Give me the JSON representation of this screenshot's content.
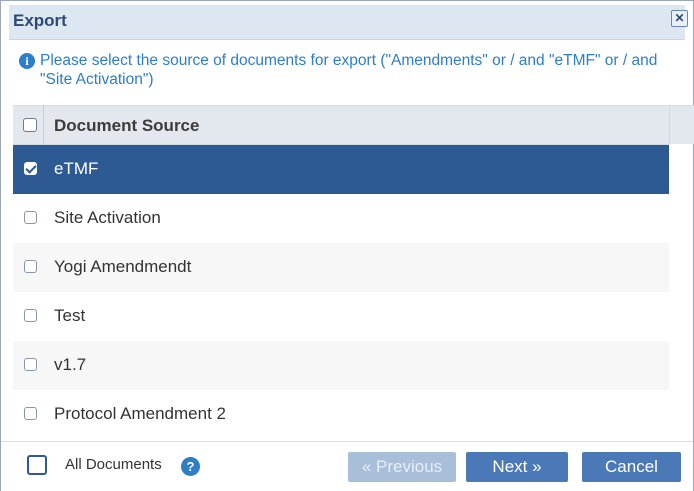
{
  "dialog": {
    "title": "Export",
    "close_icon": "close-icon",
    "info_text": "Please select the source of documents for export (\"Amendments\" or / and \"eTMF\" or / and \"Site Activation\")",
    "info_icon": "info-icon"
  },
  "grid": {
    "header_label": "Document Source",
    "header_checked": false,
    "rows": [
      {
        "label": "eTMF",
        "checked": true,
        "selected": true
      },
      {
        "label": "Site Activation",
        "checked": false,
        "selected": false
      },
      {
        "label": "Yogi Amendmendt",
        "checked": false,
        "selected": false
      },
      {
        "label": "Test",
        "checked": false,
        "selected": false
      },
      {
        "label": "v1.7",
        "checked": false,
        "selected": false
      },
      {
        "label": "Protocol Amendment 2",
        "checked": false,
        "selected": false
      }
    ]
  },
  "footer": {
    "all_documents_label": "All Documents",
    "all_documents_checked": false,
    "help_icon": "help-icon",
    "prev_label": "« Previous",
    "prev_enabled": false,
    "next_label": "Next »",
    "cancel_label": "Cancel"
  },
  "colors": {
    "accent": "#2d5a92",
    "button": "#4b79b8",
    "info": "#2d7ec4"
  }
}
